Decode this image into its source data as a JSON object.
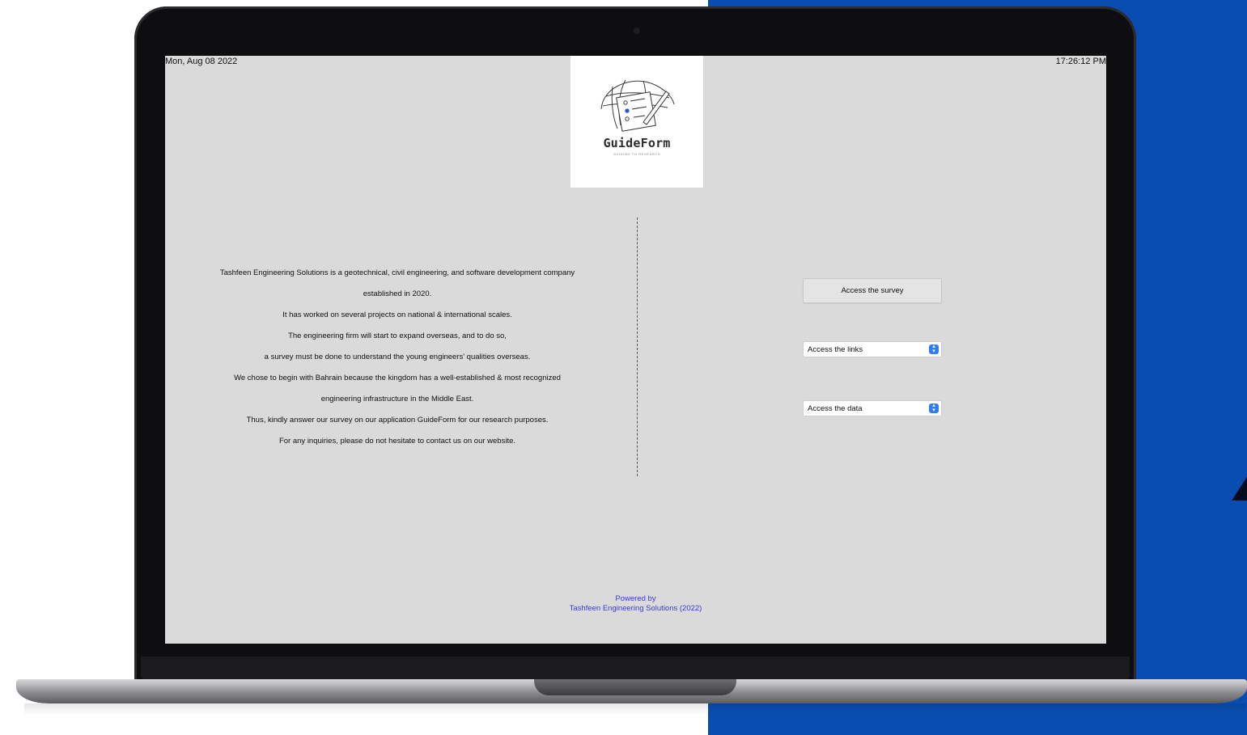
{
  "screen": {
    "date": "Mon, Aug 08 2022",
    "time": "17:26:12 PM"
  },
  "logo": {
    "name": "GuideForm",
    "tagline": "GUIDING TO RESEARCH",
    "icon": "globe-form-pen-icon"
  },
  "intro_lines": [
    "Tashfeen Engineering Solutions is a geotechnical, civil engineering, and software development company",
    "established in 2020.",
    "It has worked on several projects on national & international scales.",
    "The engineering firm will start to expand overseas, and to do so,",
    "a survey must be done to understand the young engineers' qualities overseas.",
    "We chose to begin with Bahrain because the kingdom has a well-established & most recognized",
    "engineering infrastructure in the Middle East.",
    "Thus, kindly answer our survey on our application GuideForm for our research purposes.",
    "For any inquiries, please do not hesitate to contact us on our website."
  ],
  "actions": {
    "survey_button": "Access the survey",
    "links_select": "Access the links",
    "data_select": "Access the data"
  },
  "footer": {
    "line1": "Powered by",
    "line2": "Tashfeen Engineering Solutions (2022)"
  },
  "colors": {
    "background_blue": "#0a4db0",
    "screen_gray": "#dadada",
    "footer_link": "#3a3ad0",
    "select_accent": "#2f7cf6"
  }
}
